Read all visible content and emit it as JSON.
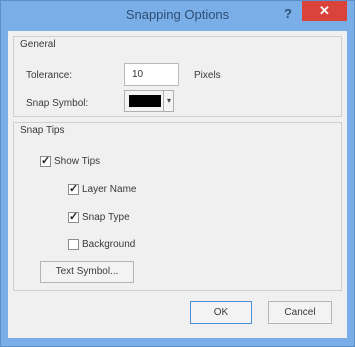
{
  "window": {
    "title": "Snapping Options",
    "help_glyph": "?",
    "close_glyph": "✕"
  },
  "general": {
    "title": "General",
    "tolerance_label": "Tolerance:",
    "tolerance_value": "10",
    "tolerance_unit": "Pixels",
    "snap_symbol_label": "Snap Symbol:",
    "snap_symbol_color": "#000000"
  },
  "snap_tips": {
    "title": "Snap Tips",
    "show_tips": {
      "label": "Show Tips",
      "checked": true
    },
    "layer_name": {
      "label": "Layer Name",
      "checked": true
    },
    "snap_type": {
      "label": "Snap Type",
      "checked": true
    },
    "background": {
      "label": "Background",
      "checked": false
    },
    "text_symbol_label": "Text Symbol..."
  },
  "buttons": {
    "ok": "OK",
    "cancel": "Cancel"
  },
  "colors": {
    "title_bar": "#7aaee8",
    "close": "#d9433a",
    "dialog_bg": "#f0f0f0"
  }
}
